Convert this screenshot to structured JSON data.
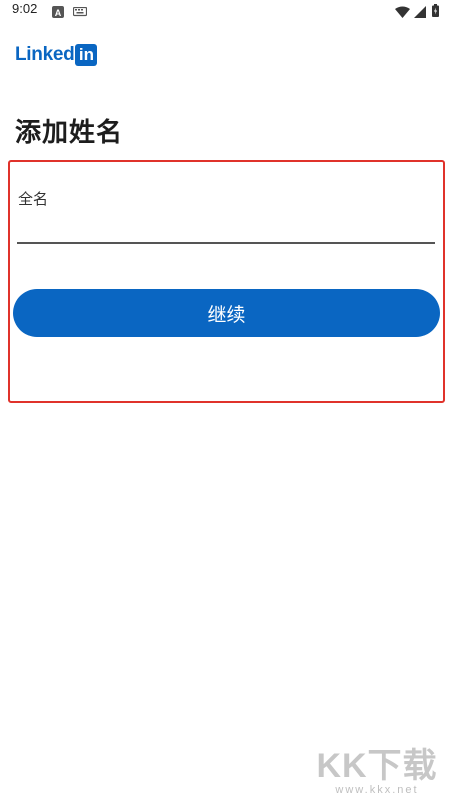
{
  "status_bar": {
    "time": "9:02",
    "icons": [
      "a-badge-icon",
      "keyboard-icon",
      "wifi-icon",
      "cellular-icon",
      "battery-icon"
    ]
  },
  "logo": {
    "text": "Linked",
    "box_text": "in",
    "brand_color": "#0a66c2"
  },
  "form": {
    "title": "添加姓名",
    "full_name_label": "全名",
    "full_name_value": "",
    "continue_label": "继续"
  },
  "watermark": {
    "brand": "KK下载",
    "url": "www.kkx.net"
  },
  "colors": {
    "accent": "#0a66c2",
    "highlight_border": "#e0322b"
  }
}
